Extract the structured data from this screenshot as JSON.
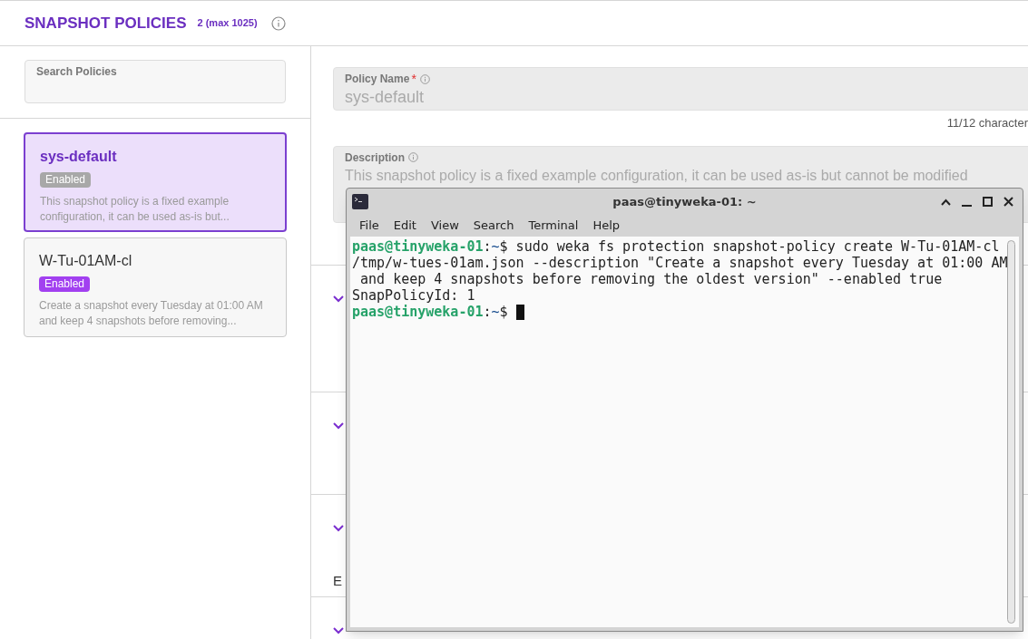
{
  "header": {
    "title": "SNAPSHOT POLICIES",
    "count": "2 (max 1025)"
  },
  "search": {
    "placeholder": "Search Policies"
  },
  "policies": [
    {
      "name": "sys-default",
      "status": "Enabled",
      "enabled": false,
      "selected": true,
      "description": "This snapshot policy is a fixed example configuration, it can be used as-is but..."
    },
    {
      "name": "W-Tu-01AM-cl",
      "status": "Enabled",
      "enabled": true,
      "selected": false,
      "description": "Create a snapshot every Tuesday at 01:00 AM and keep 4 snapshots before removing..."
    }
  ],
  "form": {
    "policy_name": {
      "label": "Policy Name",
      "required": "*",
      "value": "sys-default",
      "counter": "11/12 character"
    },
    "description": {
      "label": "Description",
      "value": "This snapshot policy is a fixed example configuration, it can be used as-is but cannot be modified"
    },
    "sections": [
      {
        "expanded": true
      },
      {
        "expanded": true
      },
      {
        "expanded": true,
        "text": "E"
      },
      {
        "expanded": true
      }
    ]
  },
  "terminal": {
    "title": "paas@tinyweka-01: ~",
    "menu": [
      "File",
      "Edit",
      "View",
      "Search",
      "Terminal",
      "Help"
    ],
    "lines": [
      {
        "user": "paas@tinyweka-01",
        "sep": ":",
        "path": "~",
        "text": "$ sudo weka fs protection snapshot-policy create W-Tu-01AM-cl"
      },
      {
        "text": "/tmp/w-tues-01am.json --description \"Create a snapshot every Tuesday at 01:00 AM"
      },
      {
        "text": " and keep 4 snapshots before removing the oldest version\" --enabled true"
      },
      {
        "text": "SnapPolicyId: 1"
      },
      {
        "user": "paas@tinyweka-01",
        "sep": ":",
        "path": "~",
        "text": "$ ",
        "cursor": true
      }
    ]
  }
}
